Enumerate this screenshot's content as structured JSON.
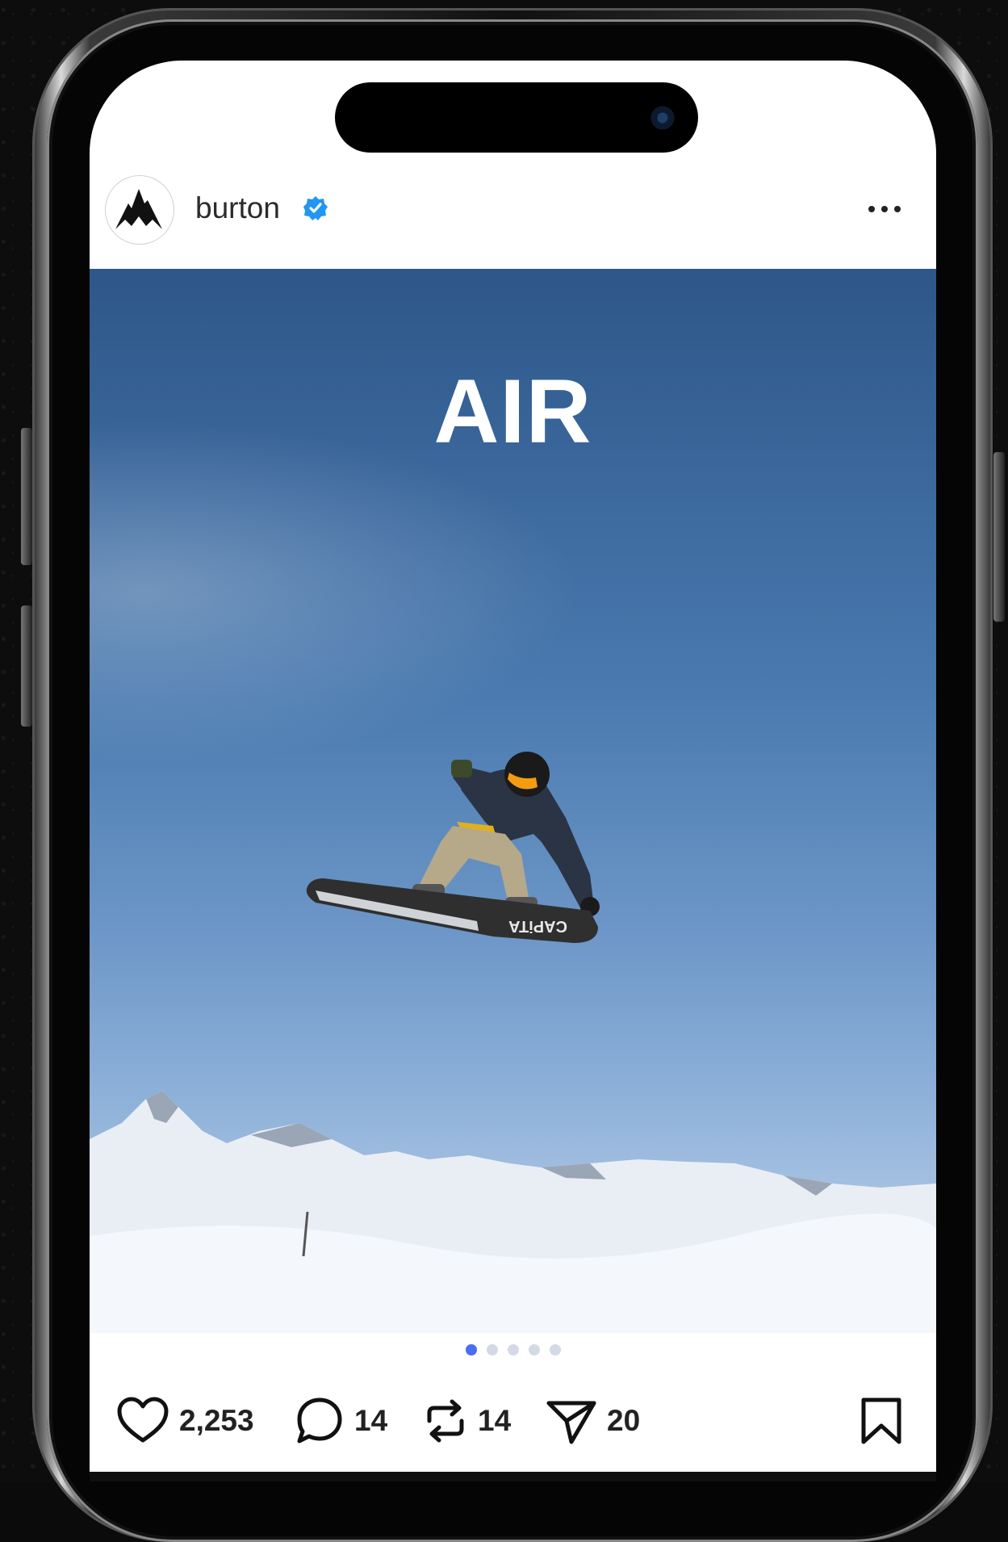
{
  "post": {
    "username": "burton",
    "verified": true,
    "image_text": "AIR",
    "board_brand": "CAPiTA",
    "carousel": {
      "count": 5,
      "active_index": 0
    }
  },
  "actions": {
    "likes": "2,253",
    "comments": "14",
    "reposts": "14",
    "shares": "20"
  },
  "icons": {
    "avatar": "burton-mountain-logo-icon",
    "verified": "verified-badge-icon",
    "more": "more-options-icon",
    "like": "heart-icon",
    "comment": "comment-bubble-icon",
    "repost": "repost-icon",
    "share": "paper-plane-icon",
    "save": "bookmark-icon"
  },
  "colors": {
    "verified": "#2196f3",
    "dot_active": "#4a6ef0",
    "dot_inactive": "#d4d9e6"
  }
}
